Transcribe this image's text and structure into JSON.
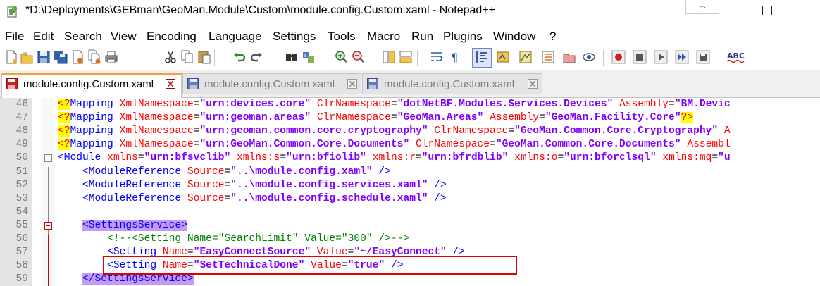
{
  "window": {
    "title": "*D:\\Deployments\\GEBman\\GeoMan.Module\\Custom\\module.config.Custom.xaml - Notepad++",
    "restore_glyph": "⇔"
  },
  "menu": {
    "items": [
      "File",
      "Edit",
      "Search",
      "View",
      "Encoding",
      "Language",
      "Settings",
      "Tools",
      "Macro",
      "Run",
      "Plugins",
      "Window",
      "?"
    ]
  },
  "tabs": [
    {
      "label": "module.config.Custom.xaml",
      "state": "active"
    },
    {
      "label": "module.config.Custom.xaml",
      "state": "inactive"
    },
    {
      "label": "module.config.Custom.xaml",
      "state": "inactive"
    }
  ],
  "editor": {
    "lines": [
      {
        "num": "46",
        "tokens": [
          {
            "t": "<?",
            "c": "pi"
          },
          {
            "t": "Mapping ",
            "c": "tag"
          },
          {
            "t": "XmlNamespace",
            "c": "attr"
          },
          {
            "t": "=",
            "c": "op"
          },
          {
            "t": "\"urn:devices.core\" ",
            "c": "val"
          },
          {
            "t": "ClrNamespace",
            "c": "attr"
          },
          {
            "t": "=",
            "c": "op"
          },
          {
            "t": "\"dotNetBF.Modules.Services.Devices\" ",
            "c": "val"
          },
          {
            "t": "Assembly",
            "c": "attr"
          },
          {
            "t": "=",
            "c": "op"
          },
          {
            "t": "\"BM.Devic",
            "c": "val"
          }
        ]
      },
      {
        "num": "47",
        "tokens": [
          {
            "t": "<?",
            "c": "pi"
          },
          {
            "t": "Mapping ",
            "c": "tag"
          },
          {
            "t": "XmlNamespace",
            "c": "attr"
          },
          {
            "t": "=",
            "c": "op"
          },
          {
            "t": "\"urn:geoman.areas\" ",
            "c": "val"
          },
          {
            "t": "ClrNamespace",
            "c": "attr"
          },
          {
            "t": "=",
            "c": "op"
          },
          {
            "t": "\"GeoMan.Areas\" ",
            "c": "val"
          },
          {
            "t": "Assembly",
            "c": "attr"
          },
          {
            "t": "=",
            "c": "op"
          },
          {
            "t": "\"GeoMan.Facility.Core\"",
            "c": "val"
          },
          {
            "t": "?>",
            "c": "pi"
          }
        ]
      },
      {
        "num": "48",
        "tokens": [
          {
            "t": "<?",
            "c": "pi"
          },
          {
            "t": "Mapping ",
            "c": "tag"
          },
          {
            "t": "XmlNamespace",
            "c": "attr"
          },
          {
            "t": "=",
            "c": "op"
          },
          {
            "t": "\"urn:geoman.common.core.cryptography\" ",
            "c": "val"
          },
          {
            "t": "ClrNamespace",
            "c": "attr"
          },
          {
            "t": "=",
            "c": "op"
          },
          {
            "t": "\"GeoMan.Common.Core.Cryptography\" ",
            "c": "val"
          },
          {
            "t": "A",
            "c": "attr"
          }
        ]
      },
      {
        "num": "49",
        "tokens": [
          {
            "t": "<?",
            "c": "pi"
          },
          {
            "t": "Mapping ",
            "c": "tag"
          },
          {
            "t": "XmlNamespace",
            "c": "attr"
          },
          {
            "t": "=",
            "c": "op"
          },
          {
            "t": "\"urn:GeoMan.Common.Core.Documents\" ",
            "c": "val"
          },
          {
            "t": "ClrNamespace",
            "c": "attr"
          },
          {
            "t": "=",
            "c": "op"
          },
          {
            "t": "\"GeoMan.Common.Core.Documents\" ",
            "c": "val"
          },
          {
            "t": "Assembl",
            "c": "attr"
          }
        ]
      },
      {
        "num": "50",
        "tokens": [
          {
            "t": "<Module ",
            "c": "tag"
          },
          {
            "t": "xmlns",
            "c": "attr"
          },
          {
            "t": "=",
            "c": "op"
          },
          {
            "t": "\"urn:bfsvclib\" ",
            "c": "val"
          },
          {
            "t": "xmlns:s",
            "c": "attr"
          },
          {
            "t": "=",
            "c": "op"
          },
          {
            "t": "\"urn:bfiolib\" ",
            "c": "val"
          },
          {
            "t": "xmlns:r",
            "c": "attr"
          },
          {
            "t": "=",
            "c": "op"
          },
          {
            "t": "\"urn:bfrdblib\" ",
            "c": "val"
          },
          {
            "t": "xmlns:o",
            "c": "attr"
          },
          {
            "t": "=",
            "c": "op"
          },
          {
            "t": "\"urn:bforclsql\" ",
            "c": "val"
          },
          {
            "t": "xmlns:mq",
            "c": "attr"
          },
          {
            "t": "=",
            "c": "op"
          },
          {
            "t": "\"u",
            "c": "val"
          }
        ]
      },
      {
        "num": "51",
        "tokens": [
          {
            "t": "    ",
            "c": "op"
          },
          {
            "t": "<ModuleReference ",
            "c": "tag"
          },
          {
            "t": "Source",
            "c": "attr"
          },
          {
            "t": "=",
            "c": "op"
          },
          {
            "t": "\"..\\module.config.xaml\" ",
            "c": "val"
          },
          {
            "t": "/>",
            "c": "tag"
          }
        ]
      },
      {
        "num": "52",
        "tokens": [
          {
            "t": "    ",
            "c": "op"
          },
          {
            "t": "<ModuleReference ",
            "c": "tag"
          },
          {
            "t": "Source",
            "c": "attr"
          },
          {
            "t": "=",
            "c": "op"
          },
          {
            "t": "\"..\\module.config.services.xaml\" ",
            "c": "val"
          },
          {
            "t": "/>",
            "c": "tag"
          }
        ]
      },
      {
        "num": "53",
        "tokens": [
          {
            "t": "    ",
            "c": "op"
          },
          {
            "t": "<ModuleReference ",
            "c": "tag"
          },
          {
            "t": "Source",
            "c": "attr"
          },
          {
            "t": "=",
            "c": "op"
          },
          {
            "t": "\"..\\module.config.schedule.xaml\" ",
            "c": "val"
          },
          {
            "t": "/>",
            "c": "tag"
          }
        ]
      },
      {
        "num": "54",
        "tokens": []
      },
      {
        "num": "55",
        "tokens": [
          {
            "t": "    ",
            "c": "op"
          },
          {
            "t": "<SettingsService>",
            "c": "match"
          }
        ]
      },
      {
        "num": "56",
        "tokens": [
          {
            "t": "        ",
            "c": "op"
          },
          {
            "t": "<!--<Setting Name=\"SearchLimit\" Value=\"300\" />-->",
            "c": "comment"
          }
        ]
      },
      {
        "num": "57",
        "tokens": [
          {
            "t": "        ",
            "c": "op"
          },
          {
            "t": "<Setting ",
            "c": "tag"
          },
          {
            "t": "Name",
            "c": "attr"
          },
          {
            "t": "=",
            "c": "op"
          },
          {
            "t": "\"EasyConnectSource\" ",
            "c": "val"
          },
          {
            "t": "Value",
            "c": "attr"
          },
          {
            "t": "=",
            "c": "op"
          },
          {
            "t": "\"~/EasyConnect\" ",
            "c": "val"
          },
          {
            "t": "/>",
            "c": "tag"
          }
        ]
      },
      {
        "num": "58",
        "tokens": [
          {
            "t": "        ",
            "c": "op"
          },
          {
            "t": "<Setting ",
            "c": "tag"
          },
          {
            "t": "Name",
            "c": "attr"
          },
          {
            "t": "=",
            "c": "op"
          },
          {
            "t": "\"SetTechnicalDone\" ",
            "c": "val"
          },
          {
            "t": "Value",
            "c": "attr"
          },
          {
            "t": "=",
            "c": "op"
          },
          {
            "t": "\"true\" ",
            "c": "val"
          },
          {
            "t": "/>",
            "c": "tag"
          }
        ]
      },
      {
        "num": "59",
        "tokens": [
          {
            "t": "    ",
            "c": "op"
          },
          {
            "t": "</SettingsService>",
            "c": "match"
          }
        ]
      }
    ]
  },
  "colors": {
    "tab_accent": "#f2a33a",
    "highlight_box": "#e00000",
    "match_brace": "#c39bf5"
  }
}
